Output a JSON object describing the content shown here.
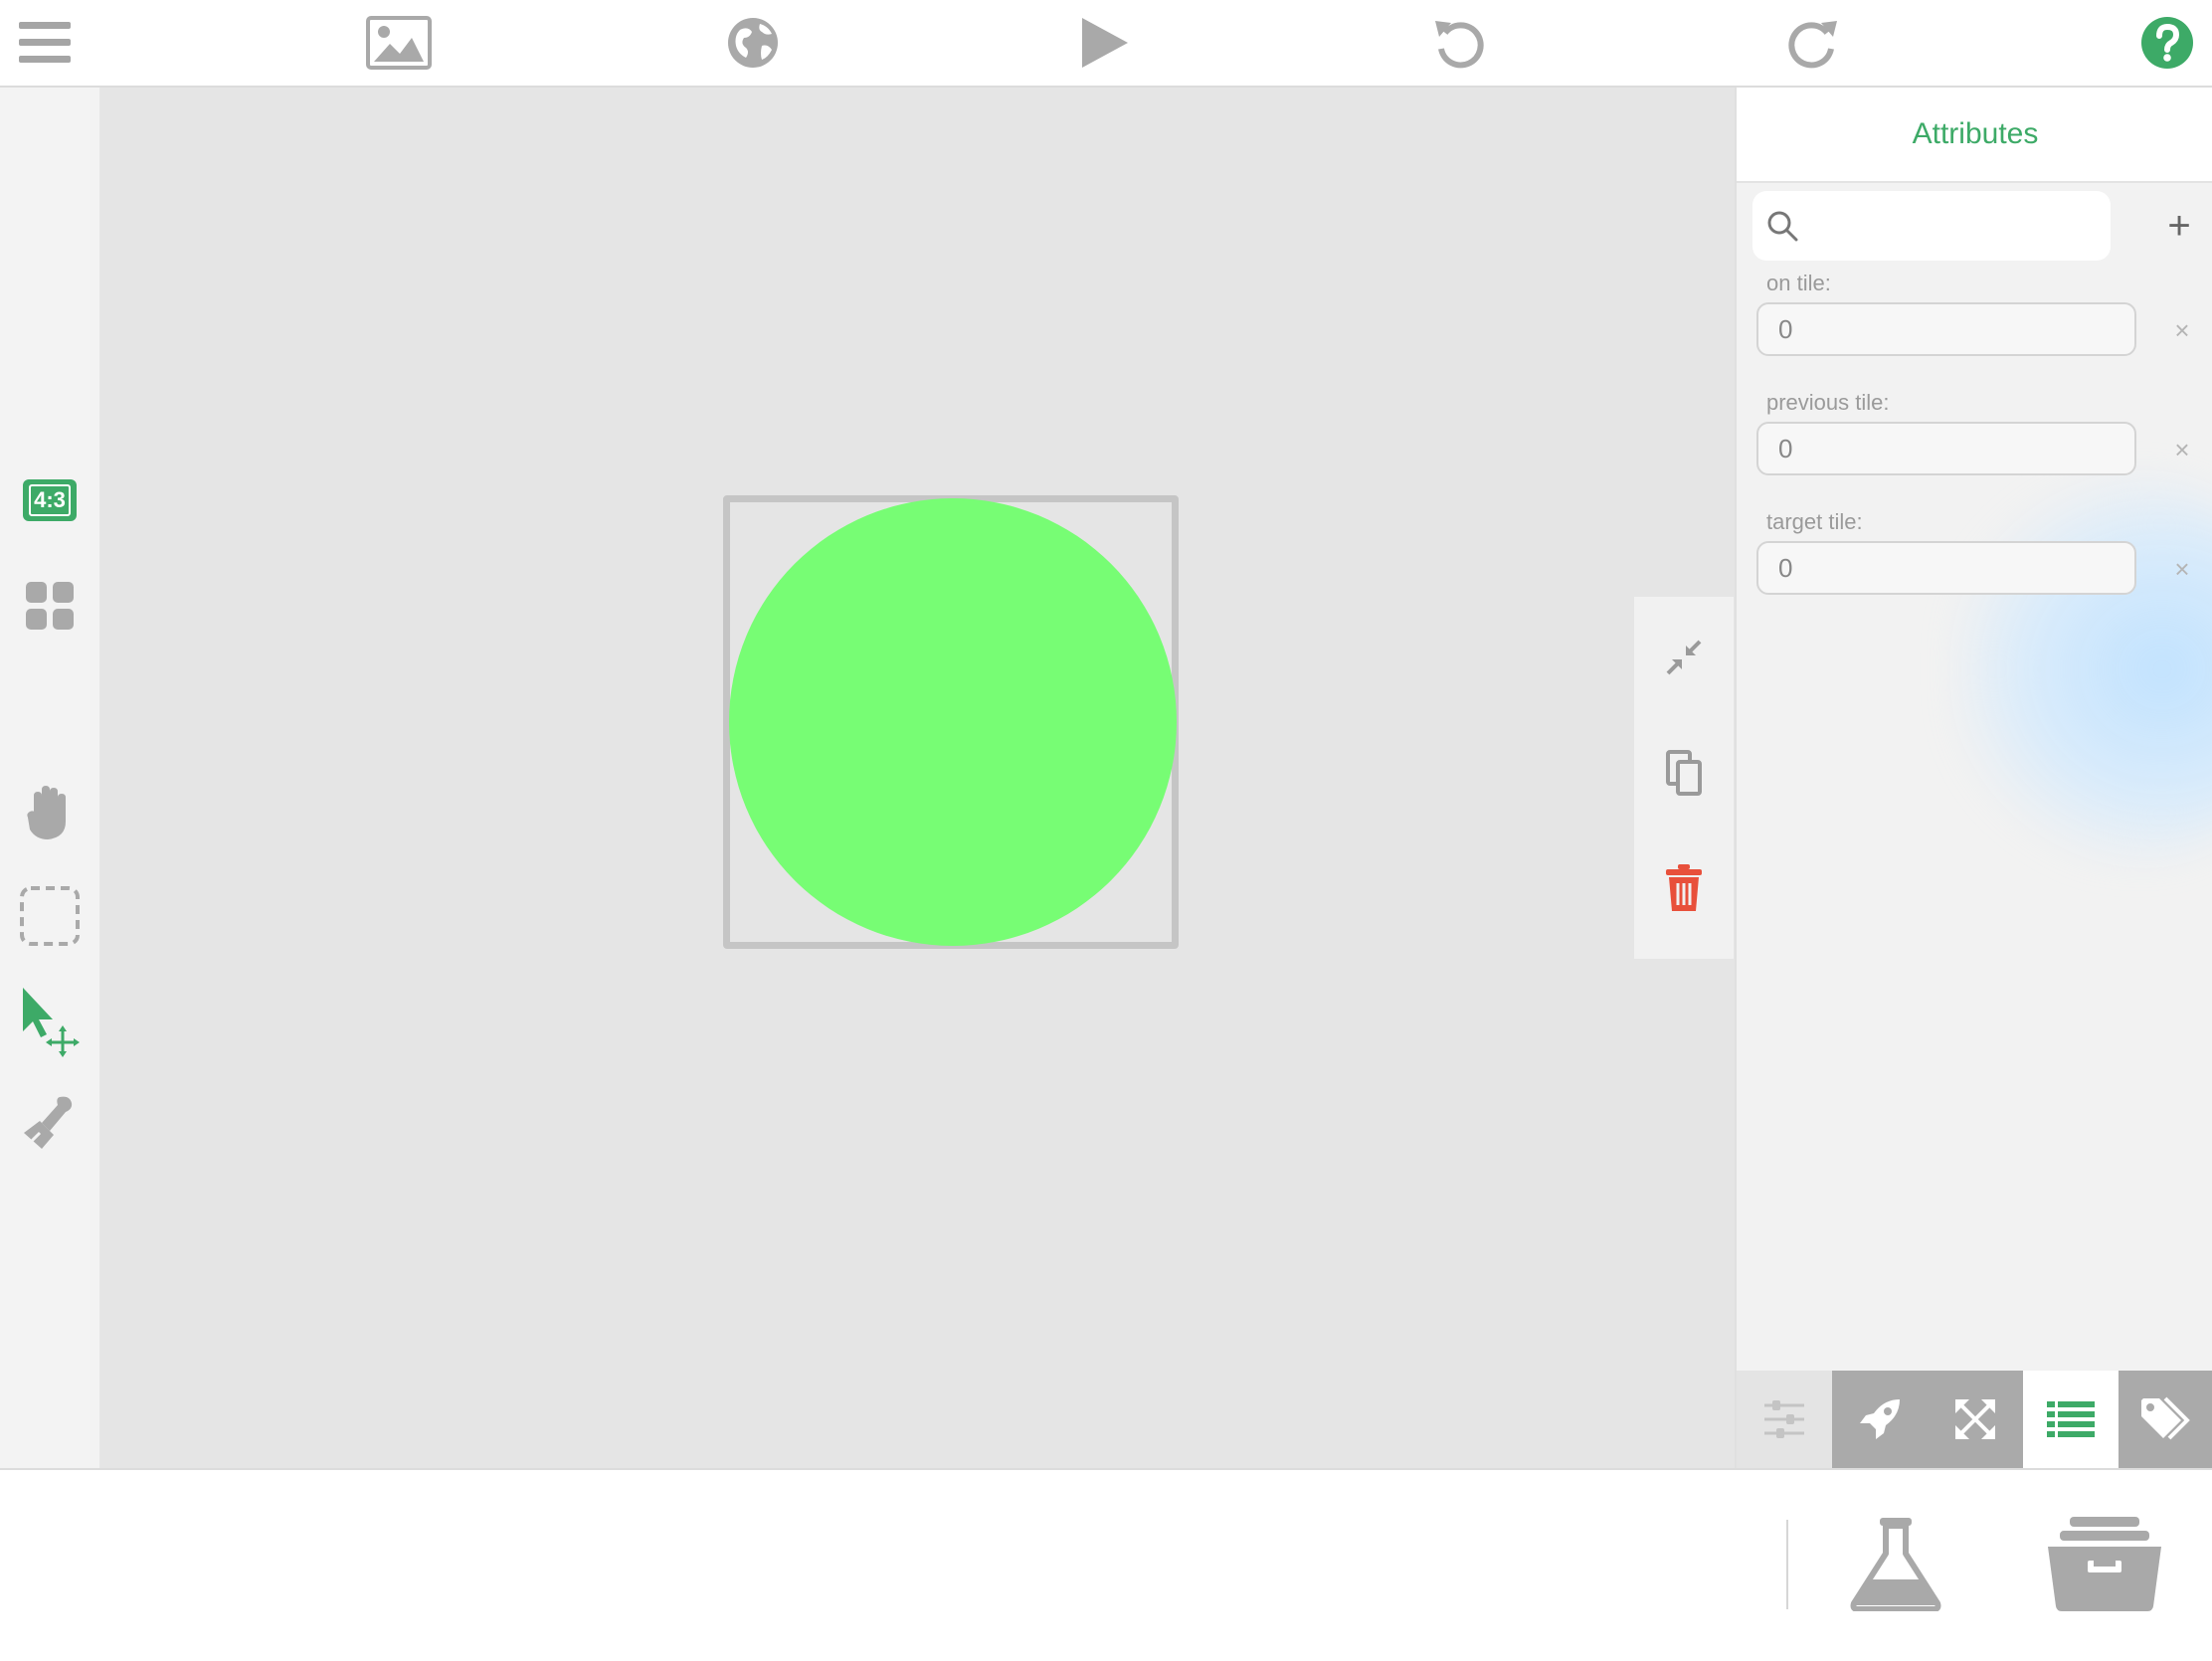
{
  "toolbar": {
    "items": [
      "menu-icon",
      "image-icon",
      "globe-icon",
      "play-icon",
      "undo-icon",
      "redo-icon",
      "help-icon"
    ]
  },
  "left_tools": {
    "aspect_ratio_label": "4:3",
    "items": [
      "aspect-ratio-icon",
      "grid-icon",
      "hand-icon",
      "marquee-select-icon",
      "pointer-move-icon",
      "stamp-icon"
    ],
    "active": "pointer-move-icon"
  },
  "canvas": {
    "shape": "circle",
    "shape_color": "#77fd74",
    "background": "#e5e5e5"
  },
  "object_actions": {
    "items": [
      "shrink-icon",
      "duplicate-icon",
      "trash-icon"
    ],
    "trash_color": "#e8503b"
  },
  "panel": {
    "title": "Attributes",
    "search": {
      "placeholder": "",
      "value": ""
    },
    "add_symbol": "+",
    "remove_symbol": "×",
    "attributes": [
      {
        "label": "on tile:",
        "value": "0"
      },
      {
        "label": "previous tile:",
        "value": "0"
      },
      {
        "label": "target tile:",
        "value": "0"
      }
    ],
    "tabs": [
      "sliders-icon",
      "rocket-icon",
      "resize-icon",
      "list-icon",
      "tag-icon"
    ],
    "active_tab": "list-icon"
  },
  "bottom_bar": {
    "items": [
      "flask-icon",
      "archive-box-icon"
    ]
  },
  "colors": {
    "accent": "#3daa67",
    "icon_gray": "#a9a9a9",
    "danger": "#e8503b"
  }
}
